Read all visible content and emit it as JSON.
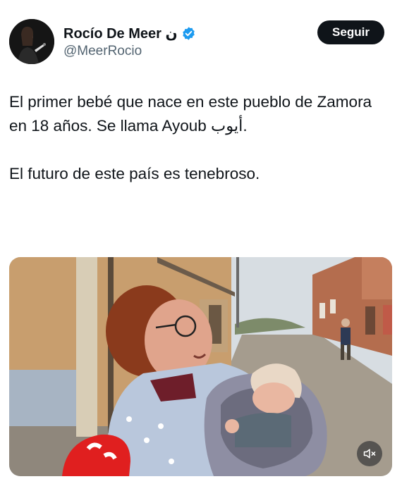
{
  "author": {
    "display_name": "Rocío De Meer ن",
    "handle": "@MeerRocio",
    "verified": true,
    "verified_color": "#1d9bf0"
  },
  "header": {
    "follow_label": "Seguir"
  },
  "tweet": {
    "paragraph_1": "El primer bebé que nace en este pueblo de Zamora en 18 años. Se llama Ayoub أيوب.",
    "paragraph_2": "El futuro de este país es tenebroso."
  },
  "media": {
    "type": "video",
    "mute_icon": "speaker-muted-icon"
  },
  "colors": {
    "text": "#0f1419",
    "secondary": "#536471",
    "button_bg": "#0f1419",
    "button_text": "#ffffff"
  }
}
